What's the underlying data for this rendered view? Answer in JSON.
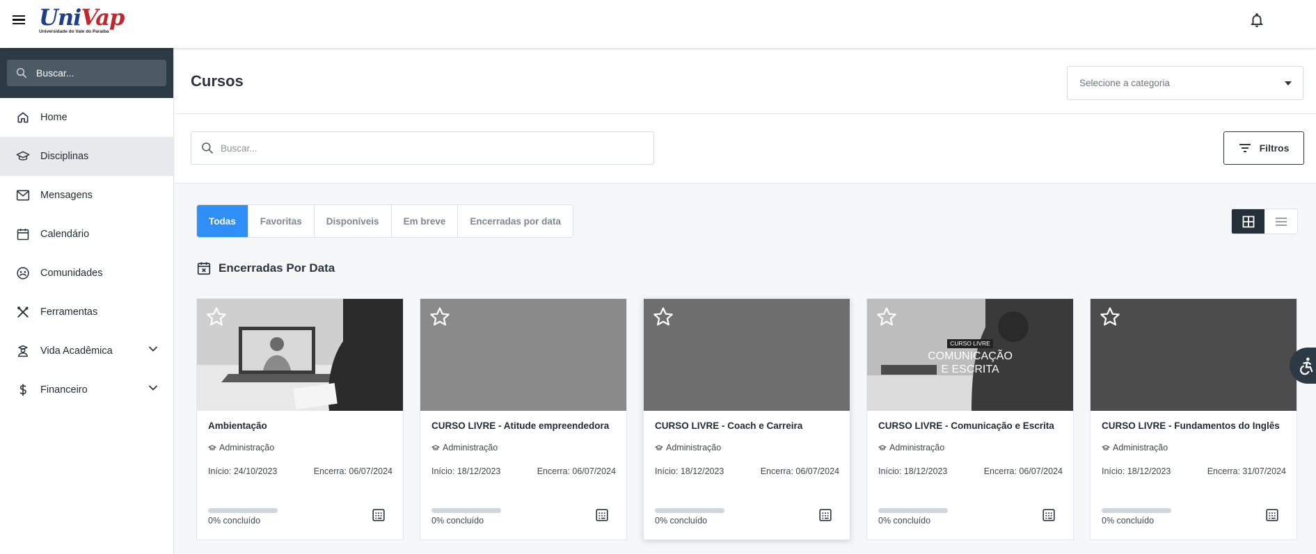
{
  "header": {
    "logo_text_a": "Uni",
    "logo_text_b": "Vap",
    "logo_subtitle": "Universidade do Vale do Paraíba"
  },
  "sidebar": {
    "search_placeholder": "Buscar...",
    "items": [
      {
        "label": "Home",
        "icon": "home-icon"
      },
      {
        "label": "Disciplinas",
        "icon": "graduation-cap-icon"
      },
      {
        "label": "Mensagens",
        "icon": "mail-icon"
      },
      {
        "label": "Calendário",
        "icon": "calendar-icon"
      },
      {
        "label": "Comunidades",
        "icon": "community-icon"
      },
      {
        "label": "Ferramentas",
        "icon": "tools-icon"
      },
      {
        "label": "Vida Acadêmica",
        "icon": "student-icon"
      },
      {
        "label": "Financeiro",
        "icon": "dollar-icon"
      }
    ]
  },
  "main": {
    "title": "Cursos",
    "category_placeholder": "Selecione a categoria",
    "search_placeholder": "Buscar...",
    "filters_label": "Filtros",
    "tabs": [
      "Todas",
      "Favoritas",
      "Disponíveis",
      "Em breve",
      "Encerradas por data"
    ],
    "section_title": "Encerradas Por Data"
  },
  "cards": [
    {
      "title": "Ambientação",
      "category": "Administração",
      "start": "Início: 24/10/2023",
      "end": "Encerra: 06/07/2024",
      "progress_label": "0% concluído",
      "progress": 0,
      "thumb_color": "#4a4a4a"
    },
    {
      "title": "CURSO LIVRE - Atitude empreendedora",
      "category": "Administração",
      "start": "Início: 18/12/2023",
      "end": "Encerra: 06/07/2024",
      "progress_label": "0% concluído",
      "progress": 0,
      "thumb_color": "#8a8a8a"
    },
    {
      "title": "CURSO LIVRE - Coach e Carreira",
      "category": "Administração",
      "start": "Início: 18/12/2023",
      "end": "Encerra: 06/07/2024",
      "progress_label": "0% concluído",
      "progress": 0,
      "thumb_color": "#6e6e6e"
    },
    {
      "title": "CURSO LIVRE - Comunicação e Escrita",
      "category": "Administração",
      "start": "Início: 18/12/2023",
      "end": "Encerra: 06/07/2024",
      "progress_label": "0% concluído",
      "progress": 0,
      "thumb_color": "#5a5a5a",
      "thumb_tag": "CURSO LIVRE",
      "thumb_line1": "COMUNICAÇÃO",
      "thumb_line2": "E ESCRITA"
    },
    {
      "title": "CURSO LIVRE - Fundamentos do Inglês",
      "category": "Administração",
      "start": "Início: 18/12/2023",
      "end": "Encerra: 31/07/2024",
      "progress_label": "0% concluído",
      "progress": 0,
      "thumb_color": "#4c4c4c"
    }
  ]
}
